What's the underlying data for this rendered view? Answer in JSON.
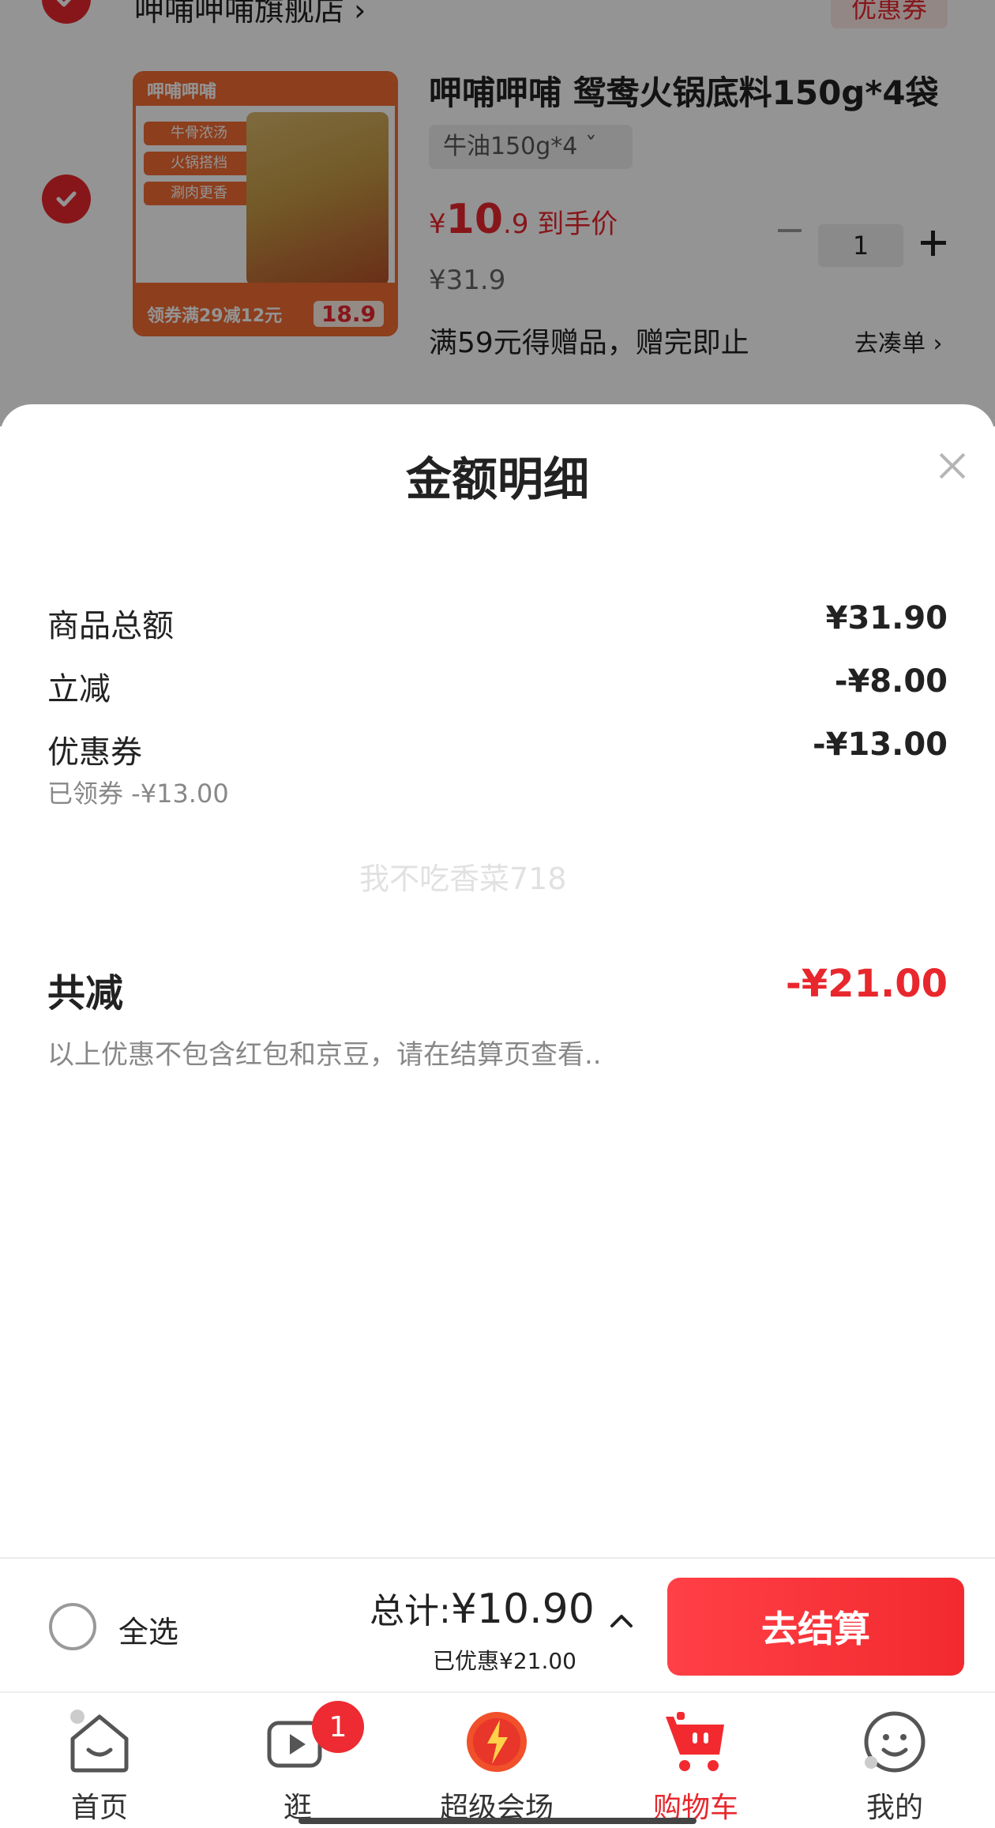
{
  "cart": {
    "shop_name": "呷哺呷哺旗舰店 ›",
    "shop_coupon": "优惠券",
    "product": {
      "image_brand": "呷哺呷哺",
      "image_tags": [
        "牛骨浓汤",
        "火锅搭档",
        "涮肉更香"
      ],
      "image_banner": "领券满29减12元",
      "image_price": "18.9",
      "title": "呷哺呷哺 鸳鸯火锅底料150g*4袋",
      "sku": "牛油150g*4  ˇ",
      "price_symbol": "¥",
      "price_main": "10",
      "price_decimal": ".9",
      "price_label": "到手价",
      "original_price": "¥31.9",
      "quantity": "1",
      "gift_text": "满59元得赠品，赠完即止",
      "gift_link": "去凑单 ›"
    }
  },
  "sheet": {
    "title": "金额明细",
    "rows": [
      {
        "label": "商品总额",
        "value": "¥31.90"
      },
      {
        "label": "立减",
        "value": "-¥8.00"
      },
      {
        "label": "优惠券",
        "value": "-¥13.00",
        "sub": "已领券 -¥13.00"
      }
    ],
    "total_label": "共减",
    "total_value": "-¥21.00",
    "note": "以上优惠不包含红包和京豆，请在结算页查看..",
    "watermark": "我不吃香菜718"
  },
  "checkout": {
    "select_all": "全选",
    "total_prefix": "总计:",
    "total_amount": "¥10.90",
    "saved": "已优惠¥21.00",
    "button": "去结算"
  },
  "tabs": [
    {
      "label": "首页",
      "icon": "home-icon"
    },
    {
      "label": "逛",
      "icon": "play-icon",
      "badge": "1"
    },
    {
      "label": "超级会场",
      "icon": "super-venue-icon"
    },
    {
      "label": "购物车",
      "icon": "cart-icon",
      "active": true
    },
    {
      "label": "我的",
      "icon": "profile-icon"
    }
  ],
  "colors": {
    "accent": "#e8272d",
    "button": "#f22a2f",
    "muted": "#888888"
  }
}
